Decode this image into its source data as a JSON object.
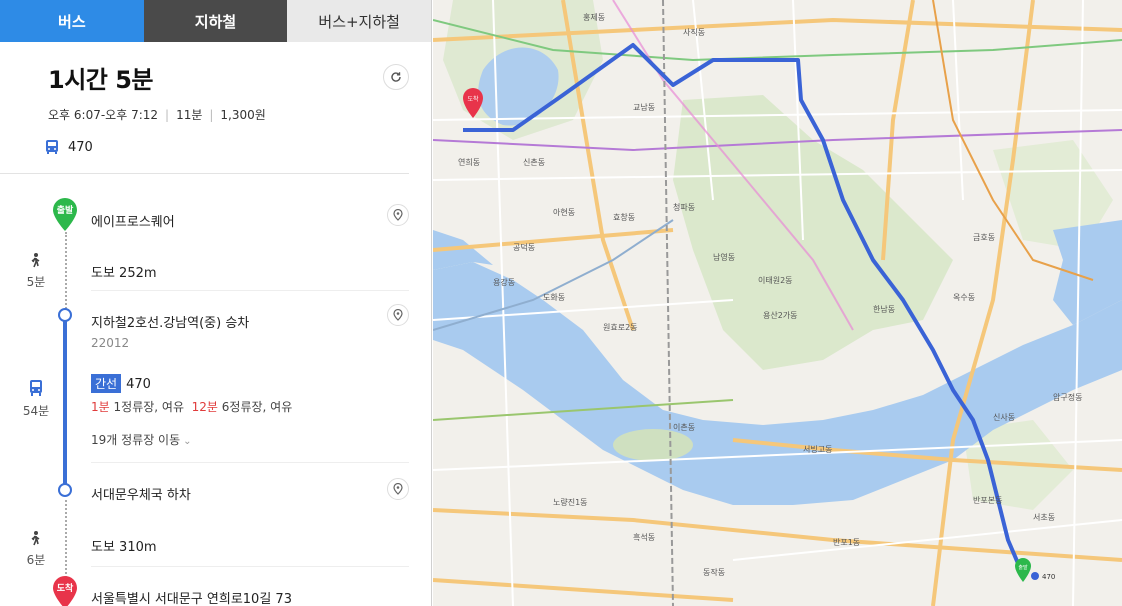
{
  "tabs": [
    {
      "label": "버스",
      "active": true
    },
    {
      "label": "지하철",
      "active": false
    },
    {
      "label": "버스+지하철",
      "active": false
    }
  ],
  "summary": {
    "total_time": "1시간 5분",
    "time_range": "오후 6:07-오후 7:12",
    "wait": "11분",
    "fare": "1,300원",
    "bus_number": "470"
  },
  "steps": {
    "start": {
      "badge": "출발",
      "name": "에이프로스퀘어"
    },
    "walk1": {
      "duration": "5분",
      "text": "도보 252m"
    },
    "board": {
      "name": "지하철2호선.강남역(중) 승차",
      "code": "22012"
    },
    "ride": {
      "duration": "54분",
      "bus_type": "간선",
      "bus_number": "470",
      "arrival1_min": "1분",
      "arrival1_info": "1정류장, 여유",
      "arrival2_min": "12분",
      "arrival2_info": "6정류장, 여유",
      "stops_move": "19개 정류장 이동"
    },
    "alight": {
      "name": "서대문우체국 하차"
    },
    "walk2": {
      "duration": "6분",
      "text": "도보 310m"
    },
    "end": {
      "badge": "도착",
      "name": "서울특별시 서대문구 연희로10길 73"
    }
  },
  "map": {
    "labels": {
      "dest_badge": "도착",
      "start_badge": "출발",
      "start_bus": "470",
      "region1": "이태원2동",
      "region2": "용산2가동",
      "region3": "한남동",
      "region4": "서빙고동",
      "region5": "압구정동",
      "region6": "반포1동",
      "region7": "반포본동",
      "region8": "신사동",
      "region9": "금호동",
      "region10": "옥수동",
      "region11": "효창동",
      "region12": "청파동",
      "region13": "남영동",
      "region14": "사직동",
      "region15": "교남동",
      "region16": "홍제동",
      "region17": "연희동",
      "region18": "신촌동",
      "region19": "아현동",
      "region20": "공덕동",
      "region21": "도화동",
      "region22": "용강동",
      "region23": "원효로2동",
      "region24": "이촌동",
      "region25": "노량진1동",
      "region26": "흑석동",
      "region27": "동작동",
      "region28": "서초동"
    },
    "colors": {
      "route": "#3a63d6",
      "water": "#a9cbef",
      "park": "#d6e6c8",
      "road": "#f5c77a"
    }
  }
}
